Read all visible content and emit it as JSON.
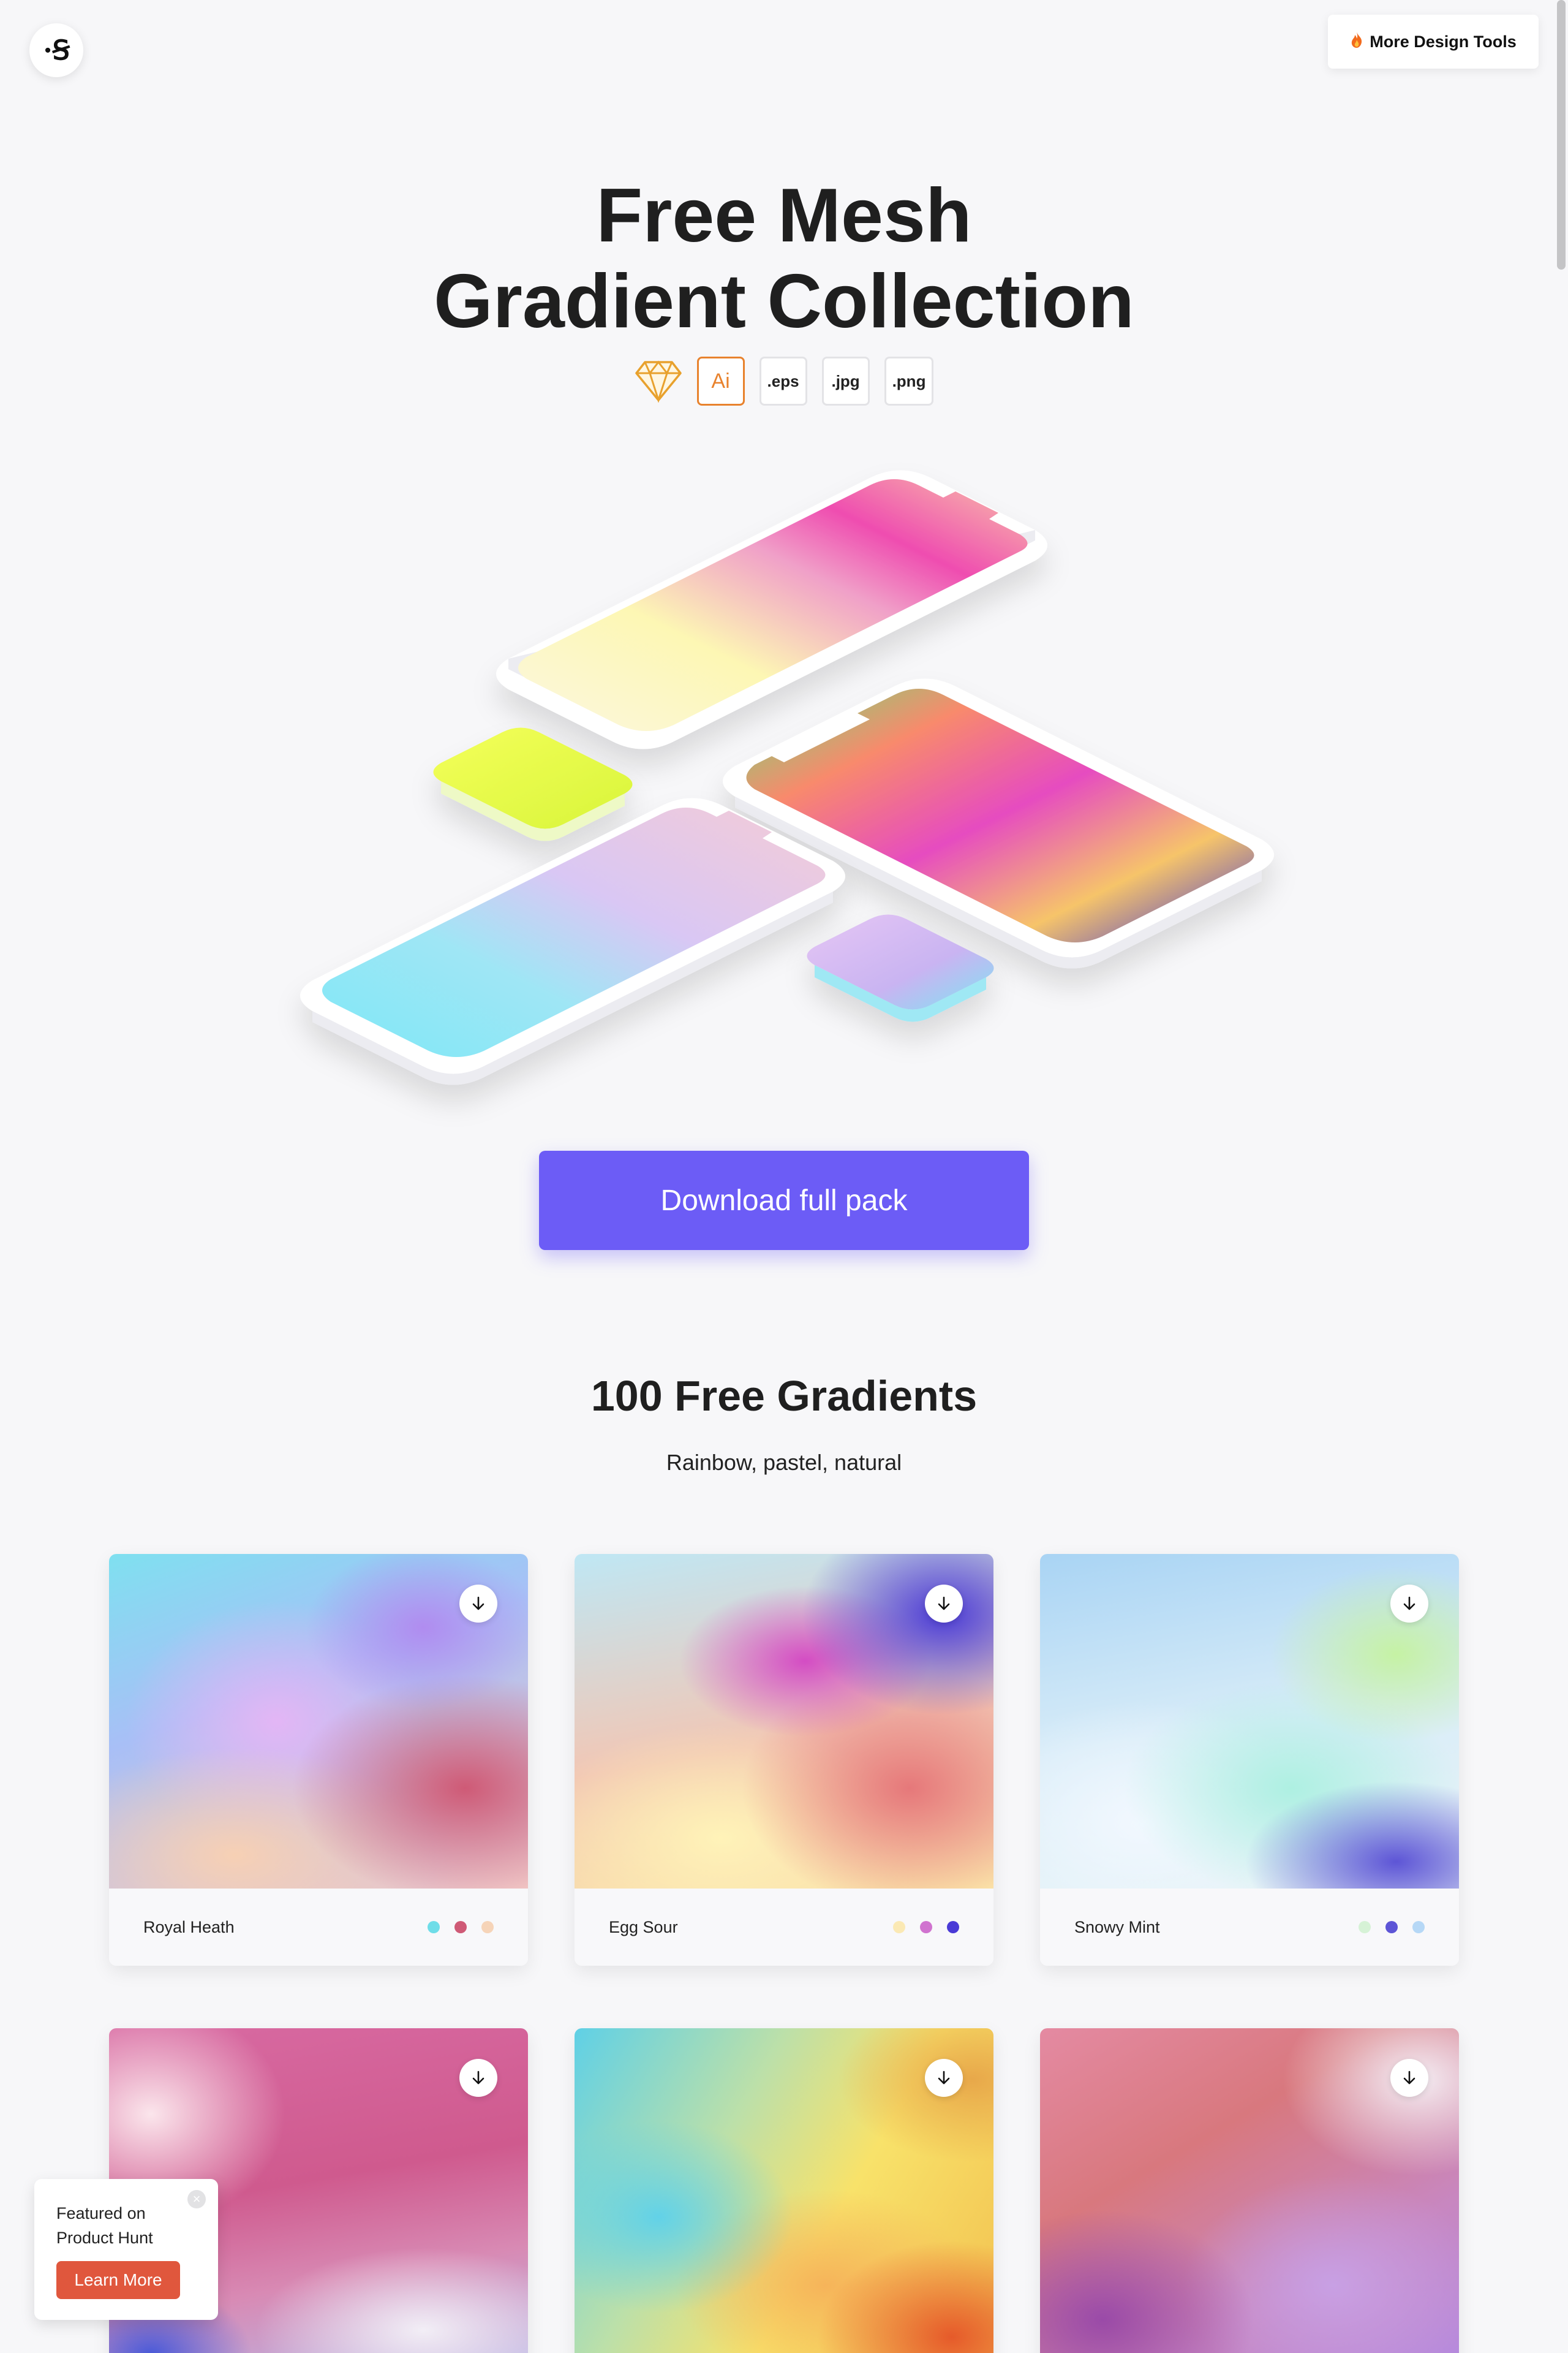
{
  "header": {
    "logo_text": "·Ꞩ",
    "more_tools_icon": "fire-icon",
    "more_tools_label": "More Design Tools"
  },
  "hero": {
    "title_line1": "Free Mesh",
    "title_line2": "Gradient Collection",
    "formats": [
      {
        "icon": "sketch-icon",
        "label": ""
      },
      {
        "icon": "illustrator-icon",
        "label": "Ai"
      },
      {
        "icon": "file-format",
        "label": ".eps"
      },
      {
        "icon": "file-format",
        "label": ".jpg"
      },
      {
        "icon": "file-format",
        "label": ".png"
      }
    ],
    "download_label": "Download full pack"
  },
  "section": {
    "title": "100 Free Gradients",
    "subtitle": "Rainbow, pastel, natural"
  },
  "cards": [
    {
      "name": "Royal Heath",
      "colors": [
        "#6fdde8",
        "#cf5a76",
        "#f6d4b8"
      ]
    },
    {
      "name": "Egg Sour",
      "colors": [
        "#fbe9b4",
        "#d073cf",
        "#4a3ad6"
      ]
    },
    {
      "name": "Snowy Mint",
      "colors": [
        "#d6f2d6",
        "#5d55d6",
        "#b6d8f6"
      ]
    },
    {
      "name": "",
      "colors": []
    },
    {
      "name": "",
      "colors": []
    },
    {
      "name": "",
      "colors": []
    }
  ],
  "product_hunt": {
    "text": "Featured on Product Hunt",
    "button": "Learn More"
  },
  "colors": {
    "accent": "#6c5cf6",
    "ph_orange": "#e0573d",
    "ai_orange": "#e8822d",
    "background": "#f7f7f9"
  }
}
